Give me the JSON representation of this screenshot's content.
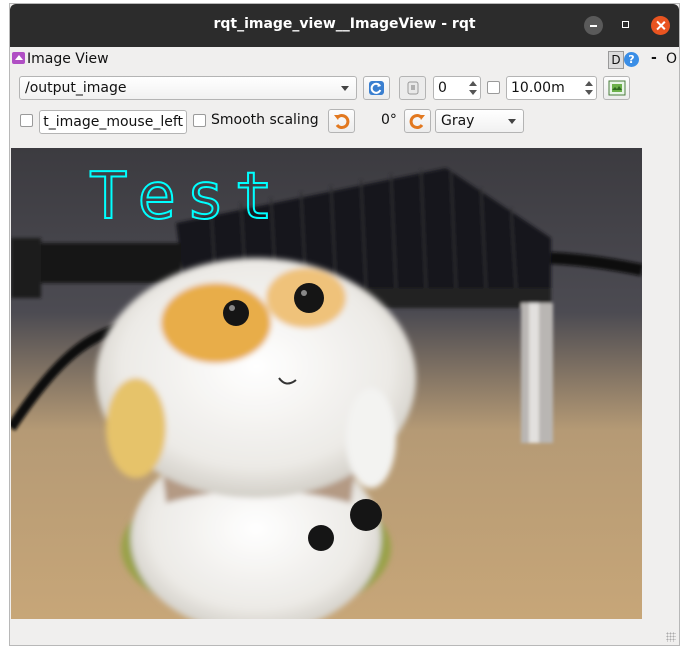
{
  "window": {
    "title": "rqt_image_view__ImageView - rqt"
  },
  "plugin": {
    "title": "Image View",
    "d_button": "D",
    "help_button": "?",
    "dash_button": "-",
    "close_button": "O"
  },
  "toolbar1": {
    "topic": "/output_image",
    "refresh_icon": "refresh-icon",
    "save_icon": "save-icon",
    "num_gridlines": "0",
    "max_range_enabled": false,
    "max_range": "10.00m",
    "zoom_fit_icon": "fit-icon"
  },
  "toolbar2": {
    "publish_click_checked": false,
    "publish_click_topic": "t_image_mouse_left",
    "smooth_scaling_checked": false,
    "smooth_scaling_label": "Smooth scaling",
    "rotate_left_icon": "rotate-ccw-icon",
    "rotation": "0°",
    "rotate_right_icon": "rotate-cw-icon",
    "colormap": "Gray"
  },
  "image": {
    "overlay_text": "Test",
    "overlay_color": "#00ffff"
  }
}
